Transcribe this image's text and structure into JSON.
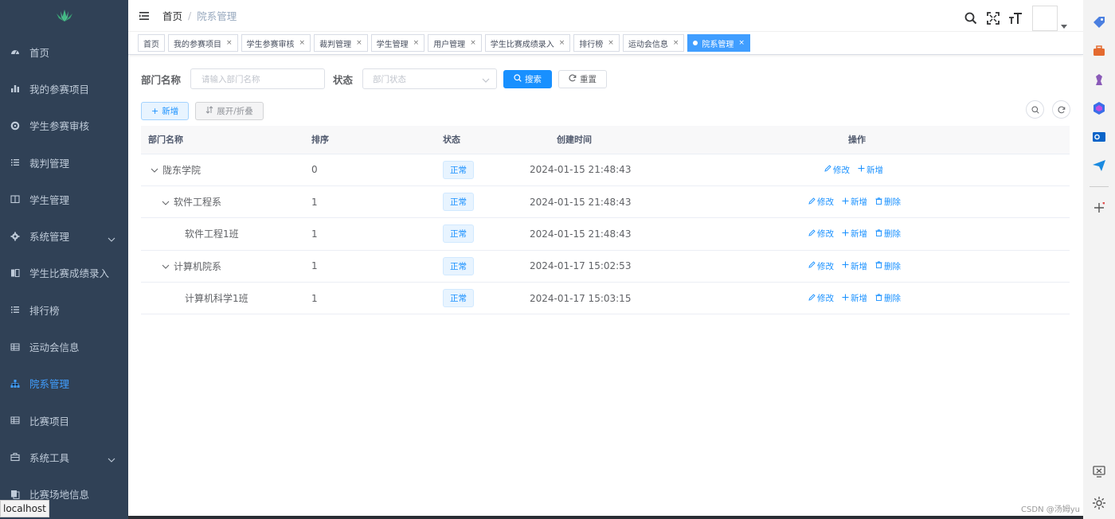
{
  "sidebar": {
    "items": [
      {
        "label": "首页",
        "icon": "dashboard-icon"
      },
      {
        "label": "我的参赛项目",
        "icon": "bar-chart-icon"
      },
      {
        "label": "学生参赛审核",
        "icon": "gear-wheel-icon"
      },
      {
        "label": "裁判管理",
        "icon": "list-icon"
      },
      {
        "label": "学生管理",
        "icon": "book-icon"
      },
      {
        "label": "系统管理",
        "icon": "settings-icon",
        "has_children": true
      },
      {
        "label": "学生比赛成绩录入",
        "icon": "document-icon"
      },
      {
        "label": "排行榜",
        "icon": "list-icon"
      },
      {
        "label": "运动会信息",
        "icon": "table-icon"
      },
      {
        "label": "院系管理",
        "icon": "tree-icon",
        "active": true
      },
      {
        "label": "比赛项目",
        "icon": "table-icon"
      },
      {
        "label": "系统工具",
        "icon": "toolbox-icon",
        "has_children": true
      },
      {
        "label": "比赛场地信息",
        "icon": "copy-icon"
      }
    ],
    "status_url": "localhost"
  },
  "breadcrumb": {
    "home": "首页",
    "separator": "/",
    "current": "院系管理"
  },
  "tags": [
    {
      "label": "首页",
      "closable": false
    },
    {
      "label": "我的参赛项目",
      "closable": true
    },
    {
      "label": "学生参赛审核",
      "closable": true
    },
    {
      "label": "裁判管理",
      "closable": true
    },
    {
      "label": "学生管理",
      "closable": true
    },
    {
      "label": "用户管理",
      "closable": true
    },
    {
      "label": "学生比赛成绩录入",
      "closable": true
    },
    {
      "label": "排行榜",
      "closable": true
    },
    {
      "label": "运动会信息",
      "closable": true
    },
    {
      "label": "院系管理",
      "closable": true,
      "active": true
    }
  ],
  "tag_close": "×",
  "search": {
    "dept_label": "部门名称",
    "dept_placeholder": "请输入部门名称",
    "status_label": "状态",
    "status_placeholder": "部门状态",
    "search_button": "搜索",
    "reset_button": "重置"
  },
  "toolbar": {
    "add_button": "新增",
    "expand_button": "展开/折叠"
  },
  "table": {
    "columns": [
      "部门名称",
      "排序",
      "状态",
      "创建时间",
      "操作"
    ],
    "rows": [
      {
        "name": "陇东学院",
        "level": 0,
        "expandable": true,
        "order": "0",
        "status": "正常",
        "created": "2024-01-15 21:48:43",
        "ops": [
          "修改",
          "新增"
        ]
      },
      {
        "name": "软件工程系",
        "level": 1,
        "expandable": true,
        "order": "1",
        "status": "正常",
        "created": "2024-01-15 21:48:43",
        "ops": [
          "修改",
          "新增",
          "删除"
        ]
      },
      {
        "name": "软件工程1班",
        "level": 2,
        "expandable": false,
        "order": "1",
        "status": "正常",
        "created": "2024-01-15 21:48:43",
        "ops": [
          "修改",
          "新增",
          "删除"
        ]
      },
      {
        "name": "计算机院系",
        "level": 1,
        "expandable": true,
        "order": "1",
        "status": "正常",
        "created": "2024-01-17 15:02:53",
        "ops": [
          "修改",
          "新增",
          "删除"
        ]
      },
      {
        "name": "计算机科学1班",
        "level": 2,
        "expandable": false,
        "order": "1",
        "status": "正常",
        "created": "2024-01-17 15:03:15",
        "ops": [
          "修改",
          "新增",
          "删除"
        ]
      }
    ]
  },
  "watermark": "CSDN @汤姆yu",
  "colors": {
    "primary": "#1890ff",
    "sidebar_bg": "#304156",
    "sidebar_text": "#bfcbd9",
    "active_menu": "#409eff"
  }
}
